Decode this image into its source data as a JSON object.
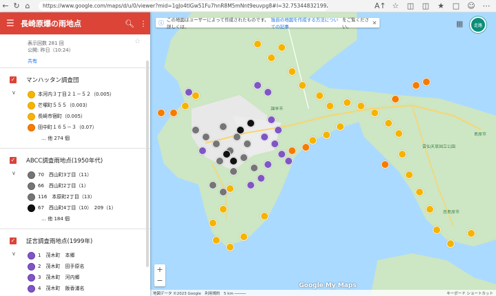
{
  "browser": {
    "url": "https://www.google.com/maps/d/u/0/viewer?mid=1gJo4tlGw51Fu7hnR8M5mNnt9euvpg8#l=32.75344832199239%2C130.0455098..."
  },
  "header": {
    "title": "長崎原爆の雨地点"
  },
  "meta": {
    "views": "表示回数 281 回",
    "published": "公開: 昨日（10:24）",
    "share": "共有"
  },
  "layers": [
    {
      "title": "マンハッタン調査団",
      "items": [
        {
          "label": "本河内３丁目２１－５２（0.005）",
          "pin": "orange"
        },
        {
          "label": "芒塚町５５５（0.003）",
          "pin": "orange"
        },
        {
          "label": "長崎市宿町（0.005）",
          "pin": "orange"
        },
        {
          "label": "田中町１６５－３（0.07）",
          "pin": "orange2"
        }
      ],
      "more": "… 他 274 個"
    },
    {
      "title": "ABCC調査雨地点(1950年代)",
      "items": [
        {
          "label": "70　西山町3丁目（11）",
          "pin": "gray"
        },
        {
          "label": "66　西山町2丁目（1）",
          "pin": "gray"
        },
        {
          "label": "116　本原町2丁目（13）",
          "pin": "gray"
        },
        {
          "label": "67　西山町4丁目（10）　209（1）",
          "pin": "black"
        }
      ],
      "more": "… 他 184 個"
    },
    {
      "title": "証言調査雨地点(1999年)",
      "items": [
        {
          "label": "1　茂木町　本郷",
          "pin": "purple"
        },
        {
          "label": "2　茂木町　田手原名",
          "pin": "purple"
        },
        {
          "label": "3　茂木町　河内郷",
          "pin": "purple"
        },
        {
          "label": "4　茂木町　飯香浦名",
          "pin": "purple"
        }
      ]
    }
  ],
  "map": {
    "notice_prefix": "この地図はユーザーによって作成されたものです。詳しくは、",
    "notice_link": "独自の地図を作成する方法についての記事",
    "notice_suffix": "をご覧ください。",
    "avatar": "走路",
    "brand": "Google My Maps",
    "attribution": "地図データ ©2023 Google　利用規約　5 km ─────",
    "shortcuts": "キーボード ショートカット",
    "places": [
      "雲仙天草国立公園",
      "島原市",
      "南島原市",
      "諫早市"
    ]
  },
  "colors": {
    "header": "#db4437",
    "sea": "#aadaff",
    "land": "#cde6c3",
    "orange": "#f4b400",
    "dark_orange": "#f57c00",
    "gray": "#757575",
    "purple": "#7e57c2"
  }
}
